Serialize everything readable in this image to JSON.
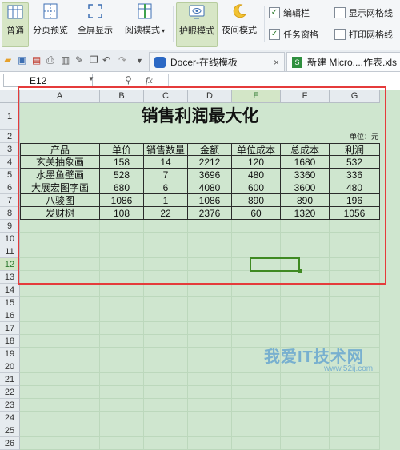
{
  "ribbon": {
    "buttons": [
      {
        "label": "普通"
      },
      {
        "label": "分页预览"
      },
      {
        "label": "全屏显示"
      },
      {
        "label": "阅读模式"
      },
      {
        "label": "护眼模式"
      },
      {
        "label": "夜间模式"
      }
    ],
    "checks": [
      {
        "label": "编辑栏",
        "checked": true
      },
      {
        "label": "任务窗格",
        "checked": true
      },
      {
        "label": "显示网格线",
        "checked": false
      },
      {
        "label": "打印网格线",
        "checked": false
      }
    ]
  },
  "tabs": [
    {
      "label": "Docer-在线模板"
    },
    {
      "label": "新建 Micro....作表.xls"
    }
  ],
  "formula_bar": {
    "cell_ref": "E12",
    "fx": "fx"
  },
  "sheet": {
    "columns": [
      "A",
      "B",
      "C",
      "D",
      "E",
      "F",
      "G"
    ],
    "rows": [
      "1",
      "2",
      "3",
      "4",
      "5",
      "6",
      "7",
      "8",
      "9",
      "10",
      "11",
      "12",
      "13",
      "14",
      "15",
      "16",
      "17",
      "18",
      "19",
      "20",
      "21",
      "22",
      "23",
      "24",
      "25",
      "26"
    ],
    "title": "销售利润最大化",
    "unit_note": "单位：元",
    "headers": [
      "产品",
      "单价",
      "销售数量",
      "金额",
      "单位成本",
      "总成本",
      "利润"
    ],
    "data": [
      [
        "玄关抽象画",
        "158",
        "14",
        "2212",
        "120",
        "1680",
        "532"
      ],
      [
        "水墨鱼壁画",
        "528",
        "7",
        "3696",
        "480",
        "3360",
        "336"
      ],
      [
        "大展宏图字画",
        "680",
        "6",
        "4080",
        "600",
        "3600",
        "480"
      ],
      [
        "八骏图",
        "1086",
        "1",
        "1086",
        "890",
        "890",
        "196"
      ],
      [
        "发财树",
        "108",
        "22",
        "2376",
        "60",
        "1320",
        "1056"
      ]
    ]
  },
  "watermark": {
    "main": "我爱IT技术网",
    "sub": "www.52ij.com"
  }
}
